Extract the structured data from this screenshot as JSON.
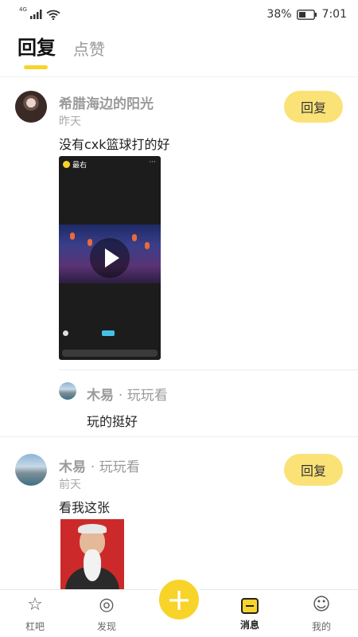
{
  "status_bar": {
    "network": "4G",
    "battery": "38%",
    "time": "7:01"
  },
  "tabs": [
    {
      "label": "回复",
      "active": true
    },
    {
      "label": "点赞",
      "active": false
    }
  ],
  "messages": [
    {
      "user": "希腊海边的阳光",
      "time": "昨天",
      "text": "没有cxk篮球打的好",
      "reply_label": "回复",
      "attachment": {
        "type": "video",
        "logo_text": "最右",
        "more": "···"
      },
      "sub_reply": {
        "user": "木易",
        "tag": "· 玩玩看",
        "text": "玩的挺好"
      }
    },
    {
      "user": "木易",
      "tag": "· 玩玩看",
      "time": "前天",
      "text": "看我这张",
      "reply_label": "回复",
      "attachment": {
        "type": "image"
      }
    }
  ],
  "bottom_nav": [
    {
      "label": "杠吧",
      "icon": "star-icon",
      "active": false
    },
    {
      "label": "发现",
      "icon": "compass-icon",
      "active": false
    },
    {
      "label": "消息",
      "icon": "message-icon",
      "active": true
    },
    {
      "label": "我的",
      "icon": "profile-icon",
      "active": false
    }
  ],
  "fab": {
    "icon": "plus-icon",
    "glyph": "+"
  },
  "colors": {
    "accent": "#f8d42a",
    "reply_button": "#fbe277"
  }
}
